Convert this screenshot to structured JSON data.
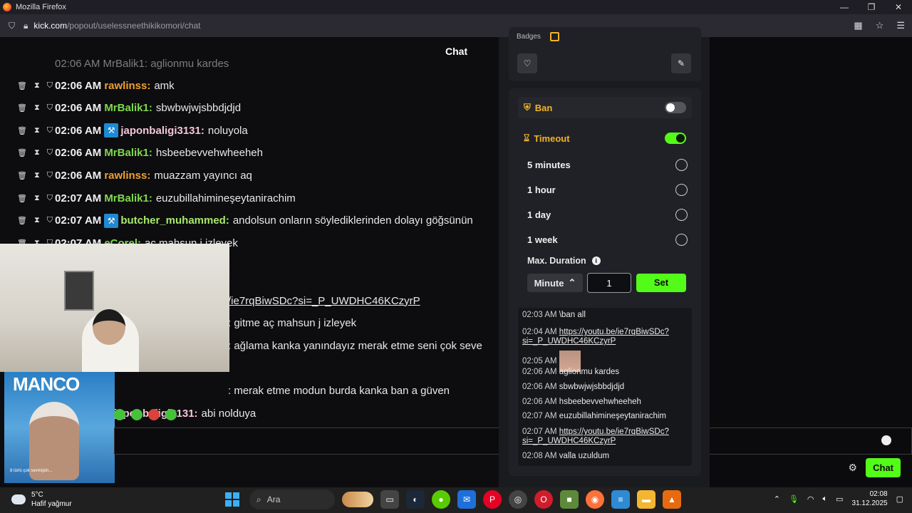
{
  "window": {
    "title": "Mozilla Firefox",
    "controls": [
      "—",
      "❐",
      "✕"
    ]
  },
  "browser": {
    "url_host": "kick.com",
    "url_path": "/popout/uselessneethikikomori/chat"
  },
  "chat": {
    "title": "Chat",
    "partial_top": "02:06 AM MrBalik1: aglionmu kardes",
    "messages": [
      {
        "time": "02:06 AM",
        "user": "rawlinss:",
        "text": "amk",
        "color": "#f0a030",
        "badge": false
      },
      {
        "time": "02:06 AM",
        "user": "MrBalik1:",
        "text": "sbwbwjwjsbbdjdjd",
        "color": "#7fd94c",
        "badge": false
      },
      {
        "time": "02:06 AM",
        "user": "japonbaligi3131:",
        "text": "noluyola",
        "color": "#f4c6d8",
        "badge": true
      },
      {
        "time": "02:06 AM",
        "user": "MrBalik1:",
        "text": "hsbeebevvehwheeheh",
        "color": "#7fd94c",
        "badge": false
      },
      {
        "time": "02:06 AM",
        "user": "rawlinss:",
        "text": "muazzam yayıncı aq",
        "color": "#f0a030",
        "badge": false
      },
      {
        "time": "02:07 AM",
        "user": "MrBalik1:",
        "text": "euzubillahimineşeytanirachim",
        "color": "#7fd94c",
        "badge": false
      },
      {
        "time": "02:07 AM",
        "user": "butcher_muhammed:",
        "text": "andolsun onların söylediklerinden dolayı göğsünün",
        "color": "#a8e86a",
        "badge": true
      },
      {
        "time": "02:07 AM",
        "user": "eCorel:",
        "text": "aç mahsun j izleyek",
        "color": "#7fd94c",
        "badge": false
      }
    ],
    "partial_lines": [
      "/ie7rqBiwSDc?si=_P_UWDHC46KCzyrP",
      ": gitme aç mahsun j izleyek",
      ": ağlama kanka yanındayız merak etme seni çok seve",
      ": merak etme modun burda kanka ban a güven"
    ],
    "last_user": "japonbaligi3131:",
    "last_text": "abi nolduya",
    "send_label": "Chat"
  },
  "album": {
    "brand": "MANCO",
    "caption": "8 türlü çok sevmiştin..."
  },
  "mod_panel": {
    "badges_label": "Badges",
    "ban_label": "Ban",
    "ban_enabled": false,
    "timeout_label": "Timeout",
    "timeout_enabled": true,
    "options": [
      "5 minutes",
      "1 hour",
      "1 day",
      "1 week"
    ],
    "max_duration_label": "Max. Duration",
    "unit": "Minute",
    "duration_value": "1",
    "set_label": "Set",
    "history": [
      {
        "time": "02:03 AM",
        "text": "\\ban all",
        "link": false
      },
      {
        "time": "02:04 AM",
        "text": "https://youtu.be/ie7rqBiwSDc?si=_P_UWDHC46KCzyrP",
        "link": true
      },
      {
        "time": "02:05 AM",
        "text": "",
        "link": false,
        "image": true
      },
      {
        "time": "02:06 AM",
        "text": "aglionmu kardes",
        "link": false
      },
      {
        "time": "02:06 AM",
        "text": "sbwbwjwjsbbdjdjd",
        "link": false
      },
      {
        "time": "02:06 AM",
        "text": "hsbeebevvehwheeheh",
        "link": false
      },
      {
        "time": "02:07 AM",
        "text": "euzubillahimineşeytanirachim",
        "link": false
      },
      {
        "time": "02:07 AM",
        "text": "https://youtu.be/ie7rqBiwSDc?si=_P_UWDHC46KCzyrP",
        "link": true
      },
      {
        "time": "02:08 AM",
        "text": "valla uzuldum",
        "link": false
      }
    ]
  },
  "taskbar": {
    "temp": "5°C",
    "weather": "Hafif yağmur",
    "search_placeholder": "Ara",
    "time": "02:08",
    "date": "31.12.2025"
  }
}
